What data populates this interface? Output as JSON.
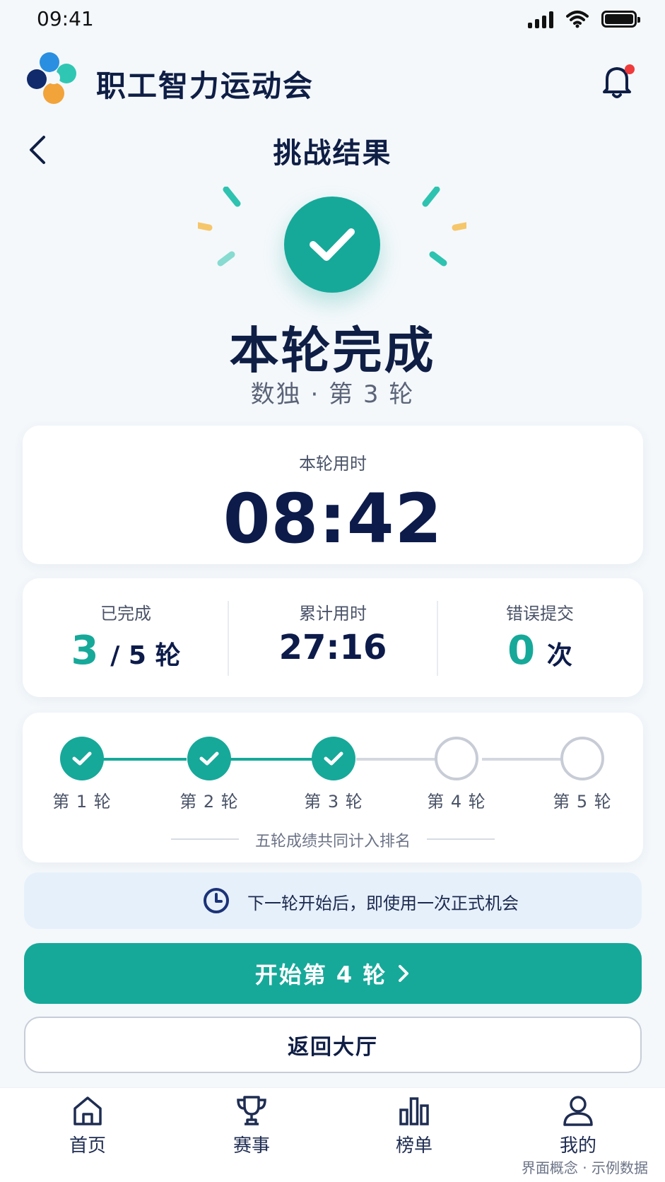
{
  "status_bar": {
    "time": "09:41"
  },
  "header": {
    "app_title": "职工智力运动会",
    "page_title": "挑战结果"
  },
  "result": {
    "headline": "本轮完成",
    "subline": "数独 · 第 3 轮"
  },
  "time_card": {
    "label": "本轮用时",
    "value": "08:42"
  },
  "stats": {
    "completed_label": "已完成",
    "completed_value": "3",
    "completed_unit": "/ 5 轮",
    "total_time_label": "累计用时",
    "total_time_value": "27:16",
    "errors_label": "错误提交",
    "errors_value": "0",
    "errors_unit": "次"
  },
  "rounds": [
    {
      "label": "第 1 轮",
      "done": true
    },
    {
      "label": "第 2 轮",
      "done": true
    },
    {
      "label": "第 3 轮",
      "done": true
    },
    {
      "label": "第 4 轮",
      "done": false
    },
    {
      "label": "第 5 轮",
      "done": false
    }
  ],
  "progress_note": "五轮成绩共同计入排名",
  "tip": {
    "text": "下一轮开始后，即使用一次正式机会"
  },
  "buttons": {
    "primary": "开始第 4 轮",
    "secondary": "返回大厅"
  },
  "tabs": [
    {
      "label": "首页",
      "icon": "home-icon"
    },
    {
      "label": "赛事",
      "icon": "trophy-icon"
    },
    {
      "label": "榜单",
      "icon": "bar-chart-icon"
    },
    {
      "label": "我的",
      "icon": "user-icon"
    }
  ],
  "footnote": "界面概念 · 示例数据",
  "colors": {
    "accent": "#16a99a",
    "navy": "#0c1b4a",
    "tip_bg": "#e6f0fb"
  }
}
